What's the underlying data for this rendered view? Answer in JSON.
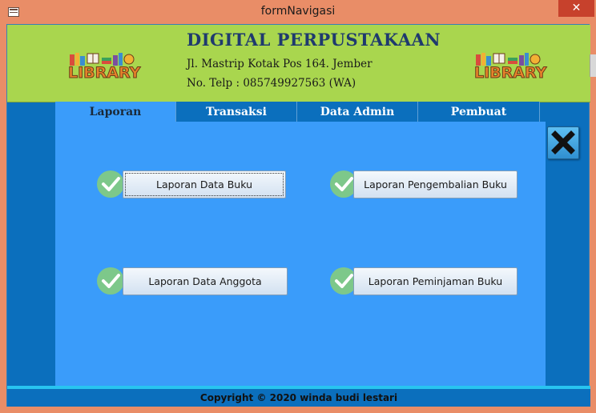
{
  "window": {
    "title": "formNavigasi",
    "close_glyph": "✕"
  },
  "header": {
    "app_title": "DIGITAL PERPUSTAKAAN",
    "address": "Jl. Mastrip Kotak Pos 164. Jember",
    "phone": "No. Telp : 085749927563 (WA)",
    "logo_text": "LIBRARY"
  },
  "tabs": [
    {
      "label": "Laporan",
      "active": true
    },
    {
      "label": "Transaksi",
      "active": false
    },
    {
      "label": "Data Admin",
      "active": false
    },
    {
      "label": "Pembuat",
      "active": false
    }
  ],
  "buttons": {
    "laporan_data_buku": "Laporan Data Buku",
    "laporan_pengembalian_buku": "Laporan Pengembalian Buku",
    "laporan_data_anggota": "Laporan Data Anggota",
    "laporan_peminjaman_buku": "Laporan Peminjaman Buku"
  },
  "footer": {
    "copyright": "Copyright © 2020 winda budi lestari"
  },
  "colors": {
    "header_bg": "#a9d64e",
    "panel_bg": "#3a9cfa",
    "frame_bg": "#0b6fbd",
    "title_color": "#1f3a6e",
    "check_green": "#7dc88a"
  },
  "icons": {
    "exit": "exit-icon",
    "check": "check-icon",
    "logo": "library-logo"
  }
}
